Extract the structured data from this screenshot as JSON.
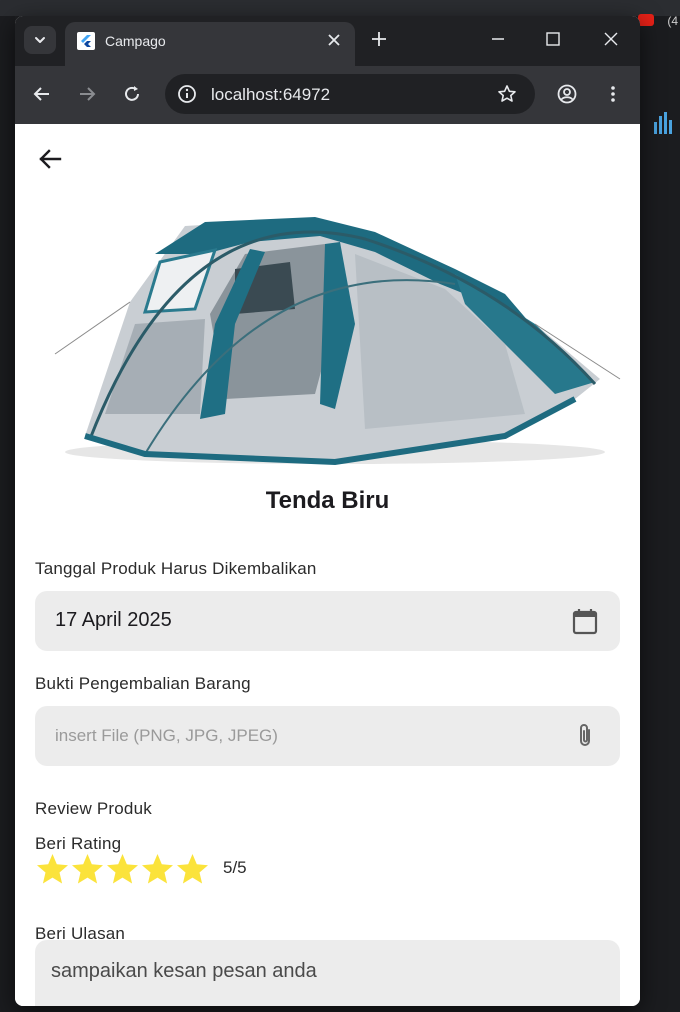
{
  "browser": {
    "tab_title": "Campago",
    "url": "localhost:64972"
  },
  "background": {
    "notification_count": "(4"
  },
  "page": {
    "product_name": "Tenda Biru",
    "return_date": {
      "label": "Tanggal Produk Harus Dikembalikan",
      "value": "17 April 2025",
      "icon": "calendar-icon"
    },
    "proof": {
      "label": "Bukti Pengembalian Barang",
      "placeholder": "insert File (PNG, JPG, JPEG)",
      "icon": "paperclip-icon"
    },
    "review": {
      "section_label": "Review Produk",
      "rating_label": "Beri Rating",
      "rating": 5,
      "rating_max": 5,
      "rating_text": "5/5",
      "star_color": "#fbe33b",
      "comment_label": "Beri Ulasan",
      "comment_placeholder": "sampaikan kesan pesan anda"
    }
  },
  "colors": {
    "browser_frame": "#202124",
    "browser_toolbar": "#35363a",
    "field_bg": "#ececec",
    "tent_teal": "#1e6b80",
    "tent_grey": "#c9ced3"
  }
}
